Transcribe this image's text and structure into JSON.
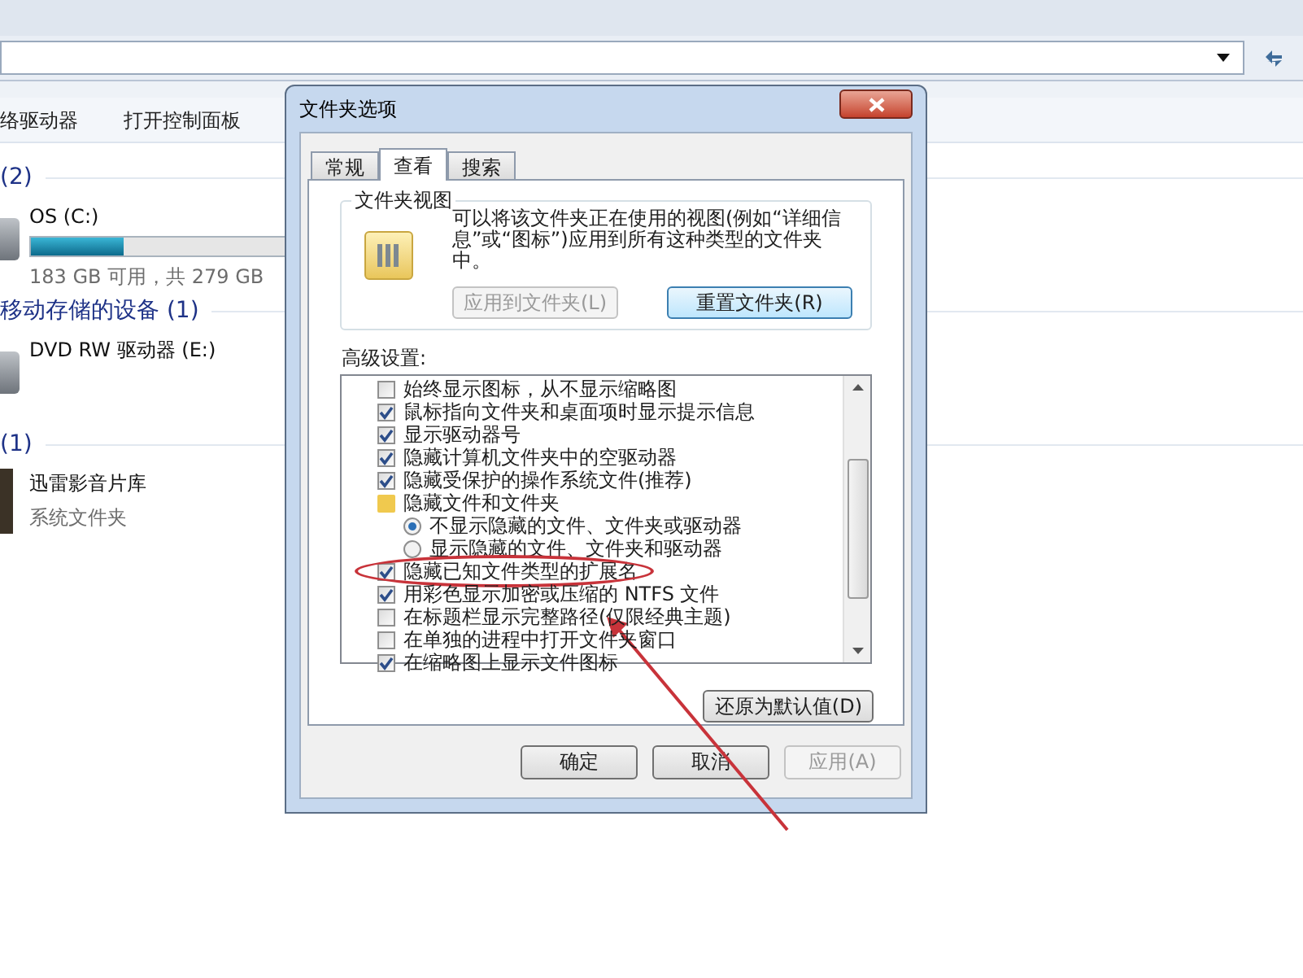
{
  "explorer": {
    "toolbar": [
      "络驱动器",
      "打开控制面板"
    ],
    "groups": [
      {
        "header": "(2)",
        "items": [
          {
            "kind": "drive",
            "name": "OS (C:)",
            "level": 0.36,
            "detail": "183 GB 可用，共 279 GB"
          }
        ]
      },
      {
        "header": "移动存储的设备 (1)",
        "items": [
          {
            "kind": "dvd",
            "name": "DVD RW 驱动器 (E:)"
          }
        ]
      },
      {
        "header": "(1)",
        "items": [
          {
            "kind": "library",
            "name": "迅雷影音片库",
            "detail": "系统文件夹"
          }
        ]
      }
    ]
  },
  "dialog": {
    "title": "文件夹选项",
    "tabs": [
      {
        "label": "常规",
        "selected": false
      },
      {
        "label": "查看",
        "selected": true
      },
      {
        "label": "搜索",
        "selected": false
      }
    ],
    "folder_views": {
      "legend": "文件夹视图",
      "description": "可以将该文件夹正在使用的视图(例如“详细信息”或“图标”)应用到所有这种类型的文件夹中。",
      "buttons": [
        {
          "label": "应用到文件夹(L)",
          "disabled": true
        },
        {
          "label": "重置文件夹(R)",
          "disabled": false
        }
      ]
    },
    "advanced_label": "高级设置:",
    "settings": [
      {
        "kind": "checkbox",
        "label": "始终显示图标，从不显示缩略图",
        "checked": false,
        "circled": false
      },
      {
        "kind": "checkbox",
        "label": "鼠标指向文件夹和桌面项时显示提示信息",
        "checked": true,
        "circled": false
      },
      {
        "kind": "checkbox",
        "label": "显示驱动器号",
        "checked": true,
        "circled": false
      },
      {
        "kind": "checkbox",
        "label": "隐藏计算机文件夹中的空驱动器",
        "checked": true,
        "circled": false
      },
      {
        "kind": "checkbox",
        "label": "隐藏受保护的操作系统文件(推荐)",
        "checked": true,
        "circled": false
      },
      {
        "kind": "folder",
        "label": "隐藏文件和文件夹",
        "children": [
          {
            "kind": "radio",
            "label": "不显示隐藏的文件、文件夹或驱动器",
            "selected": true
          },
          {
            "kind": "radio",
            "label": "显示隐藏的文件、文件夹和驱动器",
            "selected": false
          }
        ]
      },
      {
        "kind": "checkbox",
        "label": "隐藏已知文件类型的扩展名",
        "checked": true,
        "circled": true
      },
      {
        "kind": "checkbox",
        "label": "用彩色显示加密或压缩的 NTFS 文件",
        "checked": true,
        "circled": false
      },
      {
        "kind": "checkbox",
        "label": "在标题栏显示完整路径(仅限经典主题)",
        "checked": false,
        "circled": false
      },
      {
        "kind": "checkbox",
        "label": "在单独的进程中打开文件夹窗口",
        "checked": false,
        "circled": false
      },
      {
        "kind": "checkbox",
        "label": "在缩略图上显示文件图标",
        "checked": true,
        "circled": false
      }
    ],
    "restore_button": "还原为默认值(D)",
    "buttons": [
      {
        "label": "确定",
        "disabled": false
      },
      {
        "label": "取消",
        "disabled": false
      },
      {
        "label": "应用(A)",
        "disabled": true
      }
    ]
  }
}
